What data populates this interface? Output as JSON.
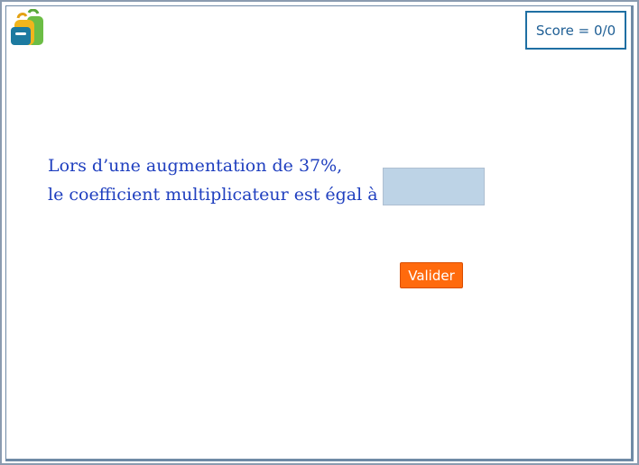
{
  "score": {
    "label": "Score = 0/0"
  },
  "question": {
    "line1": "Lors d’une augmentation de 37%,",
    "line2": "le coefficient multiplicateur est égal à"
  },
  "answer": {
    "value": "",
    "placeholder": ""
  },
  "validate": {
    "label": "Valider"
  },
  "icons": {
    "logo": "backpack-icon"
  },
  "colors": {
    "accent": "#1f6fa3",
    "question_text": "#1f3fbf",
    "button": "#ff6a0d",
    "input_bg": "#bdd3e6"
  }
}
